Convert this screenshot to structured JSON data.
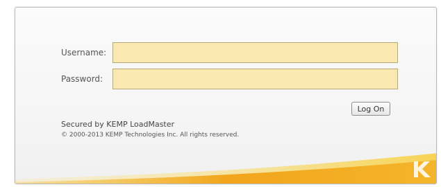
{
  "login": {
    "username_label": "Username:",
    "password_label": "Password:",
    "username_value": "",
    "password_value": "",
    "logon_button": "Log On",
    "secured_text": "Secured by KEMP LoadMaster",
    "copyright_text": "© 2000-2013 KEMP Technologies Inc. All rights reserved."
  },
  "icons": {
    "logo": "kemp-k-logo-icon"
  },
  "colors": {
    "input_fill": "#f9e9b0",
    "swoosh_orange": "#f2a51b",
    "swoosh_yellow": "#f7d354"
  }
}
